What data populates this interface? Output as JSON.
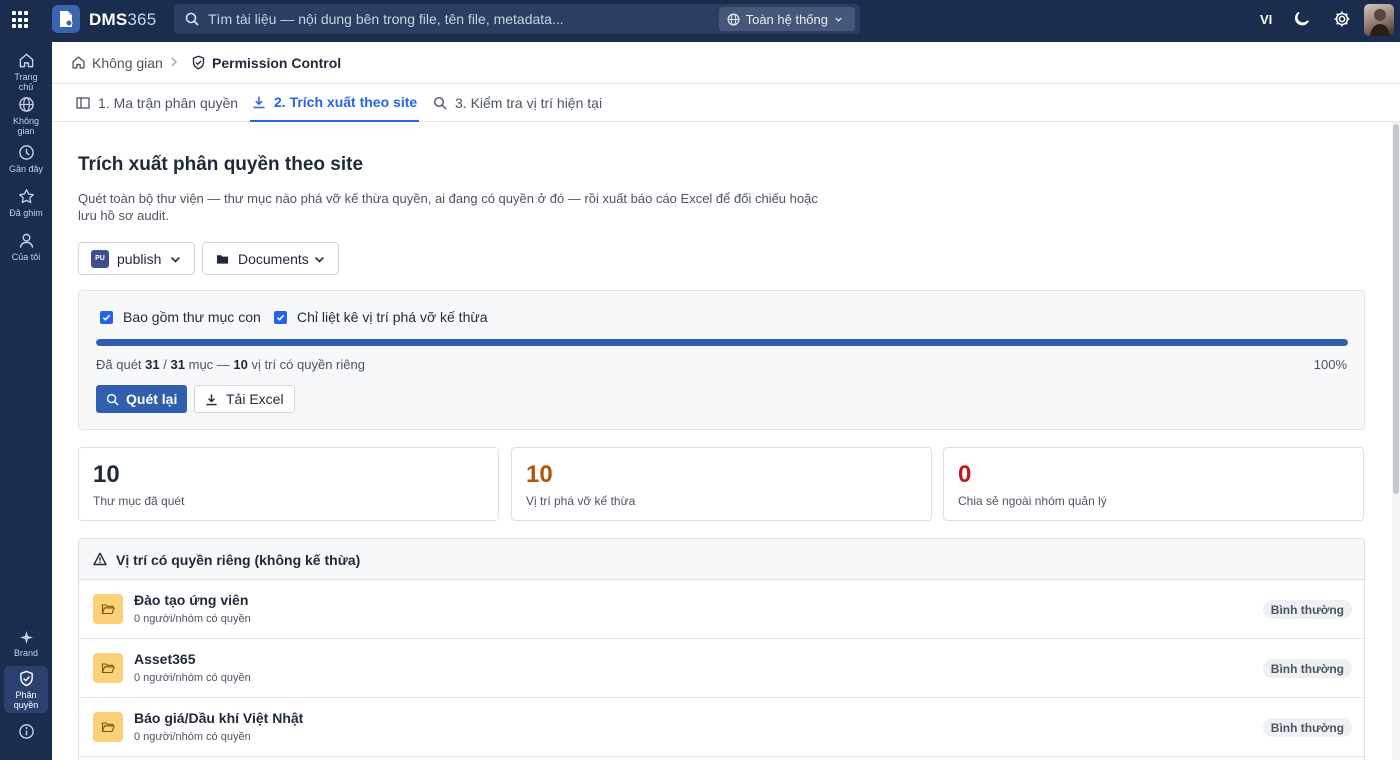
{
  "topbar": {
    "brand_bold": "DMS",
    "brand_thin": "365",
    "search_placeholder": "Tìm tài liệu — nội dung bên trong file, tên file, metadata...",
    "scope_label": "Toàn hệ thống",
    "language": "VI"
  },
  "sidebar": {
    "items": [
      {
        "label": "Trang chủ"
      },
      {
        "label": "Không gian"
      },
      {
        "label": "Gần đây"
      },
      {
        "label": "Đã ghim"
      },
      {
        "label": "Của tôi"
      },
      {
        "label": "Brand"
      },
      {
        "label": "Phân quyền"
      }
    ]
  },
  "breadcrumb": {
    "home": "Không gian",
    "current": "Permission Control"
  },
  "tabs": [
    {
      "label": "1. Ma trận phân quyền"
    },
    {
      "label": "2. Trích xuất theo site"
    },
    {
      "label": "3. Kiểm tra vị trí hiện tại"
    }
  ],
  "page": {
    "title": "Trích xuất phân quyền theo site",
    "description": "Quét toàn bộ thư viện — thư mục nào phá vỡ kế thừa quyền, ai đang có quyền ở đó — rồi xuất báo cáo Excel để đối chiếu hoặc lưu hồ sơ audit."
  },
  "selectors": {
    "site_badge": "PU",
    "site_value": "publish",
    "library_value": "Documents"
  },
  "scan": {
    "include_subfolders_label": "Bao gồm thư mục con",
    "only_broken_label": "Chỉ liệt kê vị trí phá vỡ kế thừa",
    "progress_percent": 100,
    "status_prefix": "Đã quét",
    "scanned": "31",
    "slash": "/",
    "total": "31",
    "items_word": "mục —",
    "unique_count": "10",
    "unique_suffix": "vị trí có quyền riêng",
    "percent_text": "100%",
    "rescan_label": "Quét lại",
    "download_label": "Tải Excel"
  },
  "stats": [
    {
      "value": "10",
      "label": "Thư mục đã quét",
      "color": "#1f2937"
    },
    {
      "value": "10",
      "label": "Vị trí phá vỡ kế thừa",
      "color": "#b45309"
    },
    {
      "value": "0",
      "label": "Chia sẻ ngoài nhóm quản lý",
      "color": "#b91c1c"
    }
  ],
  "unique_list": {
    "title": "Vị trí có quyền riêng (không kế thừa)",
    "rows": [
      {
        "name": "Đào tạo ứng viên",
        "sub": "0 người/nhóm có quyền",
        "status": "Bình thường"
      },
      {
        "name": "Asset365",
        "sub": "0 người/nhóm có quyền",
        "status": "Bình thường"
      },
      {
        "name": "Báo giá/Dầu khí Việt Nhật",
        "sub": "0 người/nhóm có quyền",
        "status": "Bình thường"
      }
    ]
  },
  "colors": {
    "topbar": "#1a2d4f",
    "accent": "#2563eb",
    "primary_button": "#2f5fae",
    "folder": "#fbd27a"
  }
}
